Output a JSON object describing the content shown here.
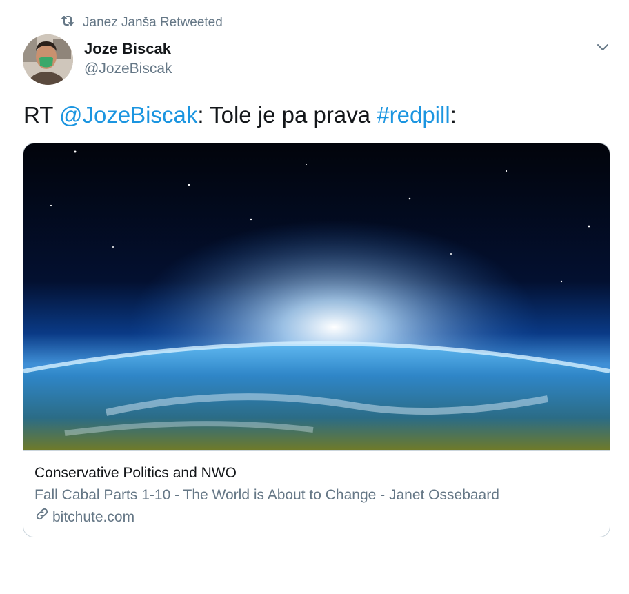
{
  "retweet": {
    "icon": "retweet-icon",
    "text": "Janez Janša Retweeted"
  },
  "author": {
    "name": "Joze Biscak",
    "handle": "@JozeBiscak",
    "avatar_icon": "avatar"
  },
  "tweet": {
    "prefix": "RT ",
    "mention": "@JozeBiscak",
    "middle": ": Tole je pa prava ",
    "hashtag": "#redpill",
    "suffix": ":"
  },
  "card": {
    "site": "Conservative Politics and NWO",
    "title": "Fall Cabal Parts 1-10 - The World is About to Change - Janet Ossebaard",
    "domain": "bitchute.com",
    "domain_icon": "link-icon"
  },
  "colors": {
    "link": "#1b95e0",
    "secondary": "#657786",
    "text": "#14171a",
    "border": "#ccd6dd"
  }
}
